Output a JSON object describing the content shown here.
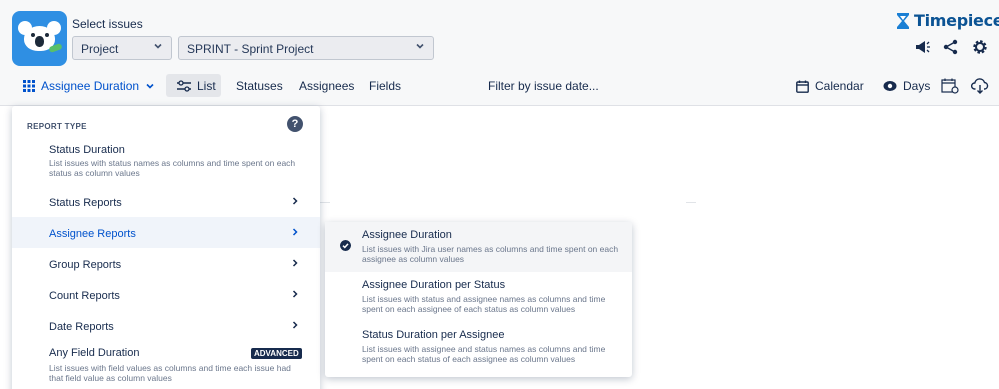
{
  "header": {
    "select_label": "Select issues",
    "project_dropdown": "Project",
    "sprint_dropdown": "SPRINT - Sprint Project",
    "brand": "Timepiece"
  },
  "toolbar": {
    "report_type": "Assignee Duration",
    "list": "List",
    "statuses": "Statuses",
    "assignees": "Assignees",
    "fields": "Fields",
    "filter": "Filter by issue date...",
    "calendar": "Calendar",
    "days": "Days"
  },
  "menu": {
    "heading": "REPORT TYPE",
    "items": [
      {
        "label": "Status Duration",
        "desc": "List issues with status names as columns and time spent on each status as column values"
      },
      {
        "label": "Status Reports"
      },
      {
        "label": "Assignee Reports"
      },
      {
        "label": "Group Reports"
      },
      {
        "label": "Count Reports"
      },
      {
        "label": "Date Reports"
      },
      {
        "label": "Any Field Duration",
        "badge": "ADVANCED",
        "desc": "List issues with field values as columns and time each issue had that field value as column values"
      }
    ]
  },
  "submenu": {
    "items": [
      {
        "label": "Assignee Duration",
        "desc": "List issues with Jira user names as columns and time spent on each assignee as column values",
        "selected": true
      },
      {
        "label": "Assignee Duration per Status",
        "desc": "List issues with status and assignee names as columns and time spent on each assignee of each status as column values"
      },
      {
        "label": "Status Duration per Assignee",
        "desc": "List issues with assignee and status names as columns and time spent on each status of each assignee as column values"
      }
    ]
  },
  "colors": {
    "accent": "#0052cc",
    "brand": "#0b5394",
    "logo_bg": "#2f8fe3"
  }
}
